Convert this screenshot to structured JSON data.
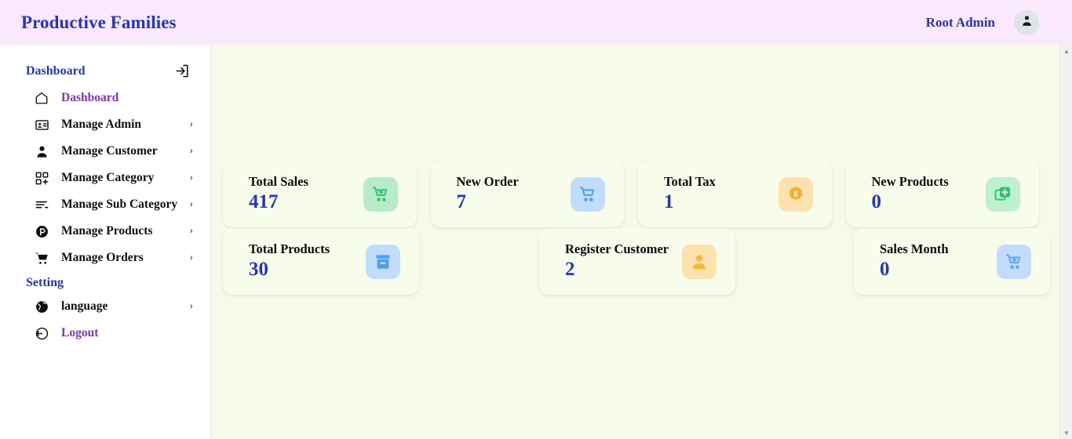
{
  "header": {
    "brand": "Productive Families",
    "user_name": "Root Admin",
    "avatar_icon": "user-avatar-icon"
  },
  "sidebar": {
    "title": "Dashboard",
    "collapse_icon": "collapse-sidebar-icon",
    "sections": [
      {
        "label": "Dashboard",
        "items": [
          {
            "label": "Dashboard",
            "icon": "home-icon",
            "chevron": "",
            "active": true
          },
          {
            "label": "Manage Admin",
            "icon": "id-card-icon",
            "chevron": "›",
            "active": false
          },
          {
            "label": "Manage Customer",
            "icon": "person-icon",
            "chevron": "›",
            "active": false
          },
          {
            "label": "Manage Category",
            "icon": "grid-plus-icon",
            "chevron": "›",
            "active": false
          },
          {
            "label": "Manage Sub Category",
            "icon": "list-icon",
            "chevron": "›",
            "active": false
          },
          {
            "label": "Manage Products",
            "icon": "p-circle-icon",
            "chevron": "›",
            "active": false
          },
          {
            "label": "Manage Orders",
            "icon": "cart-icon",
            "chevron": "›",
            "active": false
          }
        ]
      },
      {
        "label": "Setting",
        "items": [
          {
            "label": "language",
            "icon": "globe-icon",
            "chevron": "›",
            "active": false
          },
          {
            "label": "Logout",
            "icon": "logout-icon",
            "chevron": "",
            "active": true
          }
        ]
      }
    ]
  },
  "stats": {
    "row1": [
      {
        "title": "Total Sales",
        "value": "417",
        "icon": "cart-plus-icon",
        "icon_bg": "#b6ecc9",
        "icon_color": "#33c46e"
      },
      {
        "title": "New Order",
        "value": "7",
        "icon": "cart-icon",
        "icon_bg": "#c2ddfc",
        "icon_color": "#49a0f5"
      },
      {
        "title": "Total Tax",
        "value": "1",
        "icon": "dollar-badge-icon",
        "icon_bg": "#fde2b0",
        "icon_color": "#f5b02e"
      },
      {
        "title": "New Products",
        "value": "0",
        "icon": "add-layers-icon",
        "icon_bg": "#bdf0d1",
        "icon_color": "#2ec46a"
      }
    ],
    "row2": [
      {
        "title": "Total Products",
        "value": "30",
        "icon": "archive-box-icon",
        "icon_bg": "#c2ddfc",
        "icon_color": "#49a0f5"
      },
      {
        "title": "Register Customer",
        "value": "2",
        "icon": "user-filled-icon",
        "icon_bg": "#fde2b0",
        "icon_color": "#fbb63c"
      },
      {
        "title": "Sales Month",
        "value": "0",
        "icon": "cart-download-icon",
        "icon_bg": "#c2ddfc",
        "icon_color": "#5aa9f7"
      }
    ]
  },
  "scrollbar": {
    "up_arrow": "▲",
    "down_arrow": "▼"
  },
  "colors": {
    "header_bg": "#fae9fc",
    "brand_blue": "#2435c4",
    "active_purple": "#7c34c0",
    "content_bg": "#f6fbe9",
    "card_bg": "#f8fceb"
  }
}
